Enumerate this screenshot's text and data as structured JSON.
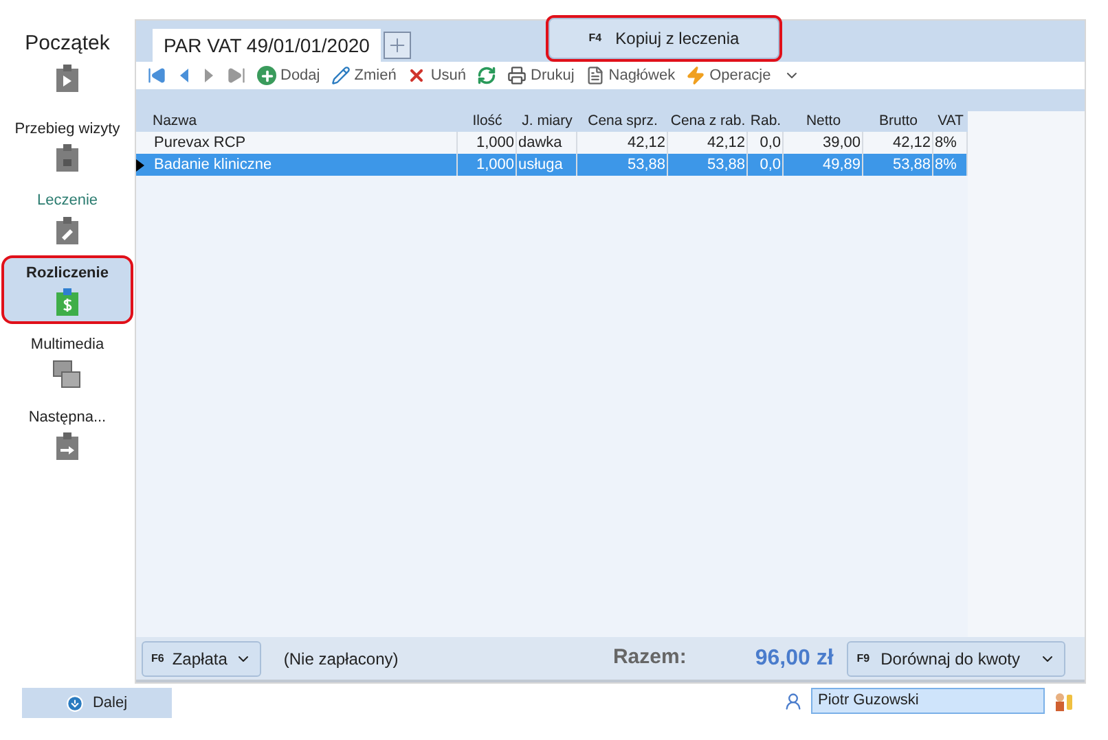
{
  "sidebar": {
    "items": [
      {
        "label": "Początek",
        "selected": false,
        "highlighted": false,
        "kind": "title"
      },
      {
        "label": "Przebieg wizyty",
        "selected": false,
        "highlighted": false,
        "kind": "item"
      },
      {
        "label": "Leczenie",
        "selected": false,
        "highlighted": false,
        "kind": "link"
      },
      {
        "label": "Rozliczenie",
        "selected": true,
        "highlighted": true,
        "kind": "item"
      },
      {
        "label": "Multimedia",
        "selected": false,
        "highlighted": false,
        "kind": "item"
      },
      {
        "label": "Następna...",
        "selected": false,
        "highlighted": false,
        "kind": "item"
      }
    ],
    "next_button": "Dalej"
  },
  "document_tab": "PAR VAT 49/01/01/2020",
  "copy_button": {
    "key": "F4",
    "label": "Kopiuj z leczenia",
    "highlighted": true
  },
  "toolbar": [
    {
      "kind": "first"
    },
    {
      "kind": "prev"
    },
    {
      "kind": "next"
    },
    {
      "kind": "last"
    },
    {
      "kind": "add",
      "label": "Dodaj"
    },
    {
      "kind": "edit",
      "label": "Zmień"
    },
    {
      "kind": "delete",
      "label": "Usuń"
    },
    {
      "kind": "refresh"
    },
    {
      "kind": "print",
      "label": "Drukuj"
    },
    {
      "kind": "header",
      "label": "Nagłówek"
    },
    {
      "kind": "operations",
      "label": "Operacje"
    }
  ],
  "table": {
    "columns": [
      "Nazwa",
      "Ilość",
      "J. miary",
      "Cena sprz.",
      "Cena z rab.",
      "Rab.",
      "Netto",
      "Brutto",
      "VAT"
    ],
    "rows": [
      {
        "selected": false,
        "cells": [
          "Purevax RCP",
          "1,000",
          "dawka",
          "42,12",
          "42,12",
          "0,0",
          "39,00",
          "42,12",
          "8%"
        ]
      },
      {
        "selected": true,
        "cells": [
          "Badanie kliniczne",
          "1,000",
          "usługa",
          "53,88",
          "53,88",
          "0,0",
          "49,89",
          "53,88",
          "8%"
        ]
      }
    ]
  },
  "footer": {
    "payment_button": {
      "key": "F6",
      "label": "Zapłata"
    },
    "payment_status": "(Nie zapłacony)",
    "total_label": "Razem:",
    "total_value": "96,00 zł",
    "adjust_button": {
      "key": "F9",
      "label": "Dorównaj do kwoty"
    }
  },
  "user_field": {
    "value": "Piotr Guzowski"
  }
}
